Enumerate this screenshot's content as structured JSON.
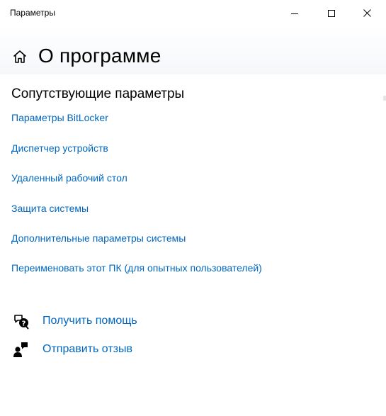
{
  "window": {
    "title": "Параметры",
    "controls": [
      "minimize-icon",
      "maximize-icon",
      "close-icon"
    ]
  },
  "header": {
    "icon": "home-icon",
    "title": "О программе"
  },
  "related": {
    "title": "Сопутствующие параметры",
    "links": [
      "Параметры BitLocker",
      "Диспетчер устройств",
      "Удаленный рабочий стол",
      "Защита системы",
      "Дополнительные параметры системы",
      "Переименовать этот ПК (для опытных пользователей)"
    ]
  },
  "actions": {
    "help": {
      "icon": "help-chat-icon",
      "label": "Получить помощь"
    },
    "feedback": {
      "icon": "feedback-icon",
      "label": "Отправить отзыв"
    }
  },
  "colors": {
    "link": "#0067c0",
    "text": "#000000",
    "background": "#ffffff"
  }
}
